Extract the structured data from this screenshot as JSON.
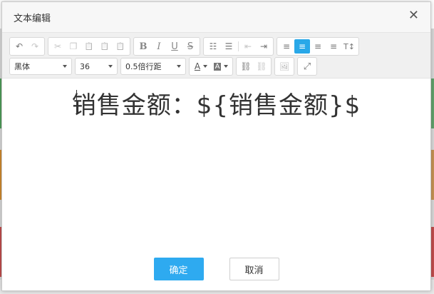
{
  "dialog": {
    "title": "文本编辑",
    "close_glyph": "✕"
  },
  "toolbar": {
    "row1": {
      "history": [
        {
          "name": "undo-icon",
          "glyph": "↶",
          "disabled": false
        },
        {
          "name": "redo-icon",
          "glyph": "↷",
          "disabled": true
        }
      ],
      "clipboard": [
        {
          "name": "cut-icon",
          "glyph": "✂",
          "disabled": true
        },
        {
          "name": "copy-icon",
          "glyph": "❐",
          "disabled": true
        },
        {
          "name": "paste-icon",
          "glyph": "📋",
          "disabled": false
        },
        {
          "name": "paste-text-icon",
          "glyph": "📋",
          "disabled": false
        },
        {
          "name": "paste-word-icon",
          "glyph": "📋",
          "disabled": false
        }
      ],
      "format": [
        {
          "name": "bold-icon",
          "glyph": "B",
          "style": "bold"
        },
        {
          "name": "italic-icon",
          "glyph": "I",
          "style": "italic"
        },
        {
          "name": "underline-icon",
          "glyph": "U",
          "style": "underline"
        },
        {
          "name": "strikethrough-icon",
          "glyph": "S",
          "style": "strike"
        }
      ],
      "lists": [
        {
          "name": "ordered-list-icon",
          "glyph": "☷"
        },
        {
          "name": "unordered-list-icon",
          "glyph": "☰"
        },
        {
          "name": "outdent-icon",
          "glyph": "⇤",
          "disabled": true
        },
        {
          "name": "indent-icon",
          "glyph": "⇥"
        }
      ],
      "align": [
        {
          "name": "align-left-icon",
          "glyph": "≡"
        },
        {
          "name": "align-center-icon",
          "glyph": "≡",
          "active": true
        },
        {
          "name": "align-right-icon",
          "glyph": "≡"
        },
        {
          "name": "align-justify-icon",
          "glyph": "≡"
        },
        {
          "name": "text-direction-icon",
          "glyph": "T↕"
        }
      ]
    },
    "row2": {
      "font_family": "黑体",
      "font_size": "36",
      "line_height": "0.5倍行距",
      "font_color_glyph": "A",
      "bg_color_glyph": "A",
      "link_glyph": "⛓",
      "unlink_glyph": "⛓",
      "image_glyph": "🖼",
      "fullscreen_glyph": "⤢"
    }
  },
  "editor": {
    "content": "销售金额：${销售金额}$"
  },
  "footer": {
    "confirm_label": "确定",
    "cancel_label": "取消"
  },
  "colors": {
    "primary": "#2eaaf0",
    "active_tool": "#29a8e8"
  }
}
